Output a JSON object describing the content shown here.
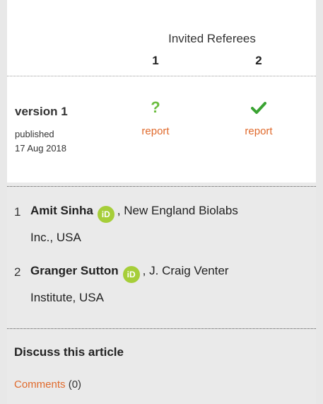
{
  "referees_header": {
    "title": "Invited Referees",
    "numbers": [
      "1",
      "2"
    ]
  },
  "version": {
    "label": "version 1",
    "published_label": "published",
    "published_date": "17 Aug 2018",
    "statuses": [
      {
        "icon": "question-icon",
        "glyph": "?",
        "report_label": "report",
        "color": "#6bbd3f"
      },
      {
        "icon": "check-icon",
        "glyph": "✔",
        "report_label": "report",
        "color": "#3aa332"
      }
    ]
  },
  "referees": [
    {
      "index": "1",
      "name": "Amit Sinha",
      "orcid_label": "iD",
      "affiliation_line1": ", New England Biolabs",
      "affiliation_line2": "Inc., USA"
    },
    {
      "index": "2",
      "name": "Granger Sutton",
      "orcid_label": "iD",
      "affiliation_line1": ", J. Craig Venter",
      "affiliation_line2": "Institute, USA"
    }
  ],
  "discuss": {
    "title": "Discuss this article",
    "comments_label": "Comments",
    "comments_count": "(0)"
  },
  "colors": {
    "link": "#e06a2c",
    "orcid": "#a6ce39"
  }
}
